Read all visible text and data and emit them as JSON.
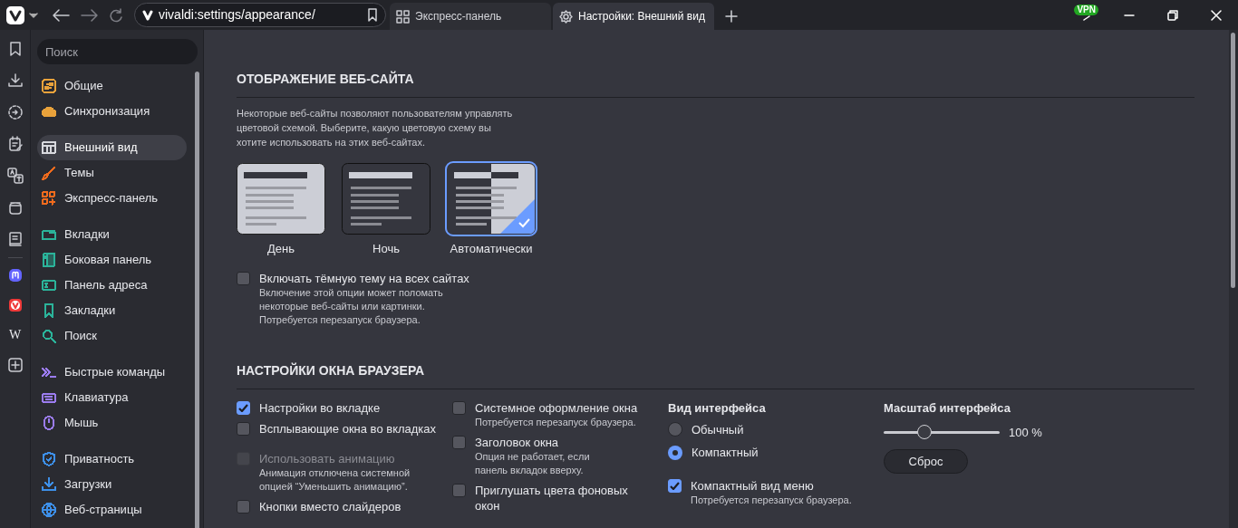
{
  "toolbar": {
    "address": "vivaldi:settings/appearance/",
    "vpn_badge": "VPN"
  },
  "tabs": [
    {
      "label": "Экспресс-панель",
      "kind": "speed-dial",
      "selected": false
    },
    {
      "label": "Настройки: Внешний вид",
      "kind": "settings",
      "selected": true
    }
  ],
  "panel": {
    "web_panel_letter": "W"
  },
  "sidebar": {
    "search": {
      "placeholder": "Поиск"
    },
    "groups": [
      [
        {
          "label": "Общие",
          "kind": "general",
          "color": "#e9a23b",
          "selected": false
        },
        {
          "label": "Синхронизация",
          "kind": "cloud",
          "color": "#e9a23b",
          "selected": false
        }
      ],
      [
        {
          "label": "Внешний вид",
          "kind": "appearance",
          "color": "#d8d9de",
          "selected": true
        },
        {
          "label": "Темы",
          "kind": "brush",
          "color": "#f26b1d",
          "selected": false
        },
        {
          "label": "Экспресс-панель",
          "kind": "grid",
          "color": "#f26b1d",
          "selected": false
        }
      ],
      [
        {
          "label": "Вкладки",
          "kind": "tabs",
          "color": "#2bb39a",
          "selected": false
        },
        {
          "label": "Боковая панель",
          "kind": "panel",
          "color": "#2bb39a",
          "selected": false
        },
        {
          "label": "Панель адреса",
          "kind": "address",
          "color": "#2bb39a",
          "selected": false
        },
        {
          "label": "Закладки",
          "kind": "bookmark",
          "color": "#2bb39a",
          "selected": false
        },
        {
          "label": "Поиск",
          "kind": "search",
          "color": "#2bb39a",
          "selected": false
        }
      ],
      [
        {
          "label": "Быстрые команды",
          "kind": "commands",
          "color": "#9b7cf0",
          "selected": false
        },
        {
          "label": "Клавиатура",
          "kind": "keyboard",
          "color": "#9b7cf0",
          "selected": false
        },
        {
          "label": "Мышь",
          "kind": "mouse",
          "color": "#9b7cf0",
          "selected": false
        }
      ],
      [
        {
          "label": "Приватность",
          "kind": "shield",
          "color": "#3d8fe8",
          "selected": false
        },
        {
          "label": "Загрузки",
          "kind": "download",
          "color": "#3d8fe8",
          "selected": false
        },
        {
          "label": "Веб-страницы",
          "kind": "globe",
          "color": "#3d8fe8",
          "selected": false
        }
      ]
    ]
  },
  "website_section": {
    "title": "ОТОБРАЖЕНИЕ ВЕБ-САЙТА",
    "description": "Некоторые веб-сайты позволяют пользователям управлять цветовой схемой. Выберите, какую цветовую схему вы хотите использовать на этих веб-сайтах.",
    "themes": [
      {
        "label": "День",
        "kind": "day",
        "selected": false
      },
      {
        "label": "Ночь",
        "kind": "night",
        "selected": false
      },
      {
        "label": "Автоматически",
        "kind": "auto",
        "selected": true
      }
    ],
    "dark_option": {
      "label": "Включать тёмную тему на всех сайтах",
      "checked": false,
      "notes": [
        "Включение этой опции может поломать",
        "некоторые веб-сайты или картинки.",
        "Потребуется перезапуск браузера."
      ]
    }
  },
  "window_section": {
    "title": "НАСТРОЙКИ ОКНА БРАУЗЕРА",
    "column_1": [
      {
        "label": "Настройки во вкладке",
        "checked": true,
        "disabled": false
      },
      {
        "label": "Всплывающие окна во вкладках",
        "checked": false,
        "disabled": false
      },
      {
        "label": "Использовать анимацию",
        "checked": false,
        "disabled": true,
        "notes": [
          "Анимация отключена системной",
          "опцией “Уменьшить анимацию”."
        ]
      },
      {
        "label": "Кнопки вместо слайдеров",
        "checked": false,
        "disabled": false
      }
    ],
    "column_2": [
      {
        "label": "Системное оформление окна",
        "checked": false,
        "disabled": false,
        "notes": [
          "Потребуется перезапуск браузера."
        ]
      },
      {
        "label": "Заголовок окна",
        "checked": false,
        "disabled": false,
        "notes": [
          "Опция не работает, если",
          "панель вкладок вверху."
        ]
      },
      {
        "label": "Приглушать цвета фоновых окон",
        "checked": false,
        "disabled": false
      }
    ],
    "interface": {
      "title": "Вид интерфейса",
      "options": [
        {
          "label": "Обычный",
          "selected": false
        },
        {
          "label": "Компактный",
          "selected": true
        }
      ],
      "compact_menu": {
        "label": "Компактный вид меню",
        "checked": true,
        "notes": [
          "Потребуется перезапуск браузера."
        ]
      }
    },
    "scale": {
      "title": "Масштаб интерфейса",
      "level": 0.35,
      "reading": "100 %",
      "reset_button": "Сброс"
    }
  }
}
